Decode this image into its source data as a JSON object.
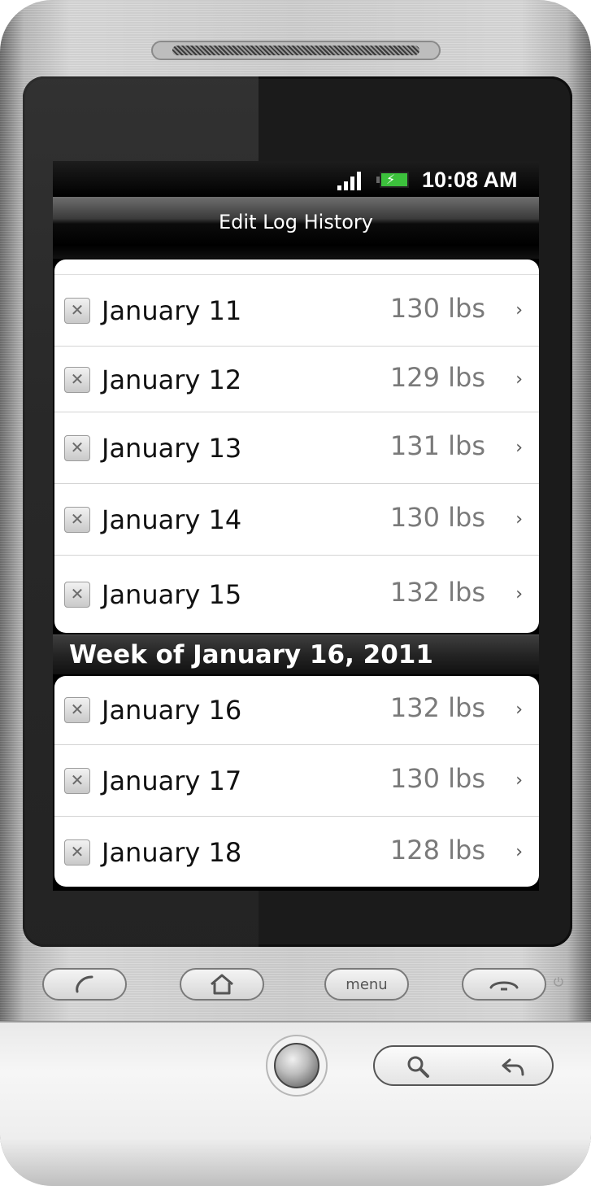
{
  "status_bar": {
    "time": "10:08 AM",
    "signal_icon": "signal-icon",
    "battery_icon": "battery-charging-icon"
  },
  "title_bar": {
    "title": "Edit Log History"
  },
  "section": {
    "header": "Week of January 16, 2011"
  },
  "entries_before": [
    {
      "date": "January 11",
      "weight": "130 lbs"
    },
    {
      "date": "January 12",
      "weight": "129 lbs"
    },
    {
      "date": "January 13",
      "weight": "131 lbs"
    },
    {
      "date": "January 14",
      "weight": "130 lbs"
    },
    {
      "date": "January 15",
      "weight": "132 lbs"
    }
  ],
  "entries_after": [
    {
      "date": "January 16",
      "weight": "132 lbs"
    },
    {
      "date": "January 17",
      "weight": "130 lbs"
    },
    {
      "date": "January 18",
      "weight": "128 lbs"
    }
  ],
  "hardware": {
    "menu_label": "menu"
  },
  "colors": {
    "list_bg": "#ffffff",
    "screen_bg": "#000000",
    "weight_text": "#7a7a7a",
    "battery_green": "#3cc13c"
  }
}
